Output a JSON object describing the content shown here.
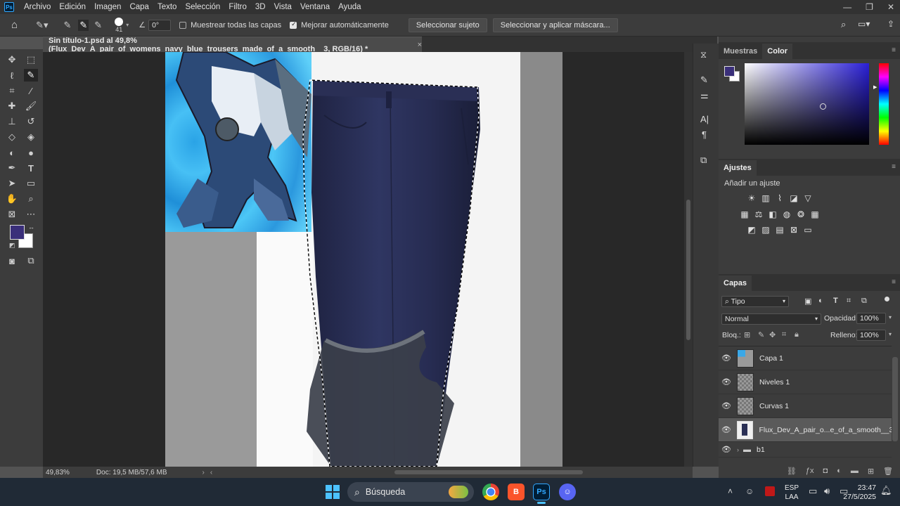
{
  "app": {
    "logo_text": "Ps",
    "menu": [
      "Archivo",
      "Edición",
      "Imagen",
      "Capa",
      "Texto",
      "Selección",
      "Filtro",
      "3D",
      "Vista",
      "Ventana",
      "Ayuda"
    ]
  },
  "options_bar": {
    "brush_size": "41",
    "angle": "0°",
    "sample_all_layers": "Muestrear todas las capas",
    "auto_enhance": "Mejorar automáticamente",
    "select_subject": "Seleccionar sujeto",
    "select_and_mask": "Seleccionar y aplicar máscara..."
  },
  "document": {
    "tab_title": "Sin título-1.psd al 49,8% (Flux_Dev_A_pair_of_womens_navy_blue_trousers_made_of_a_smooth__3, RGB/16) *",
    "close": "×"
  },
  "status": {
    "zoom": "49,83%",
    "doc_size": "Doc: 19,5 MB/57,6 MB"
  },
  "color_panel": {
    "tabs": [
      "Muestras",
      "Color"
    ],
    "active_tab": "Color",
    "foreground": "#3a2f7a",
    "background": "#ffffff",
    "picker_hue": "#2a1fd6"
  },
  "adjustments_panel": {
    "title": "Ajustes",
    "subtitle": "Añadir un ajuste"
  },
  "layers_panel": {
    "title": "Capas",
    "filter": "Tipo",
    "blend_mode": "Normal",
    "opacity_label": "Opacidad:",
    "opacity": "100%",
    "lock_label": "Bloq.:",
    "fill_label": "Relleno:",
    "fill": "100%",
    "layers": [
      {
        "name": "Capa 1",
        "selected": false
      },
      {
        "name": "Niveles 1",
        "selected": false
      },
      {
        "name": "Curvas 1",
        "selected": false
      },
      {
        "name": "Flux_Dev_A_pair_o...e_of_a_smooth__3",
        "selected": true
      }
    ],
    "group_name": "b1"
  },
  "taskbar": {
    "search": "Búsqueda",
    "lang_top": "ESP",
    "lang_bottom": "LAA",
    "time": "23:47",
    "date": "27/5/2025"
  }
}
